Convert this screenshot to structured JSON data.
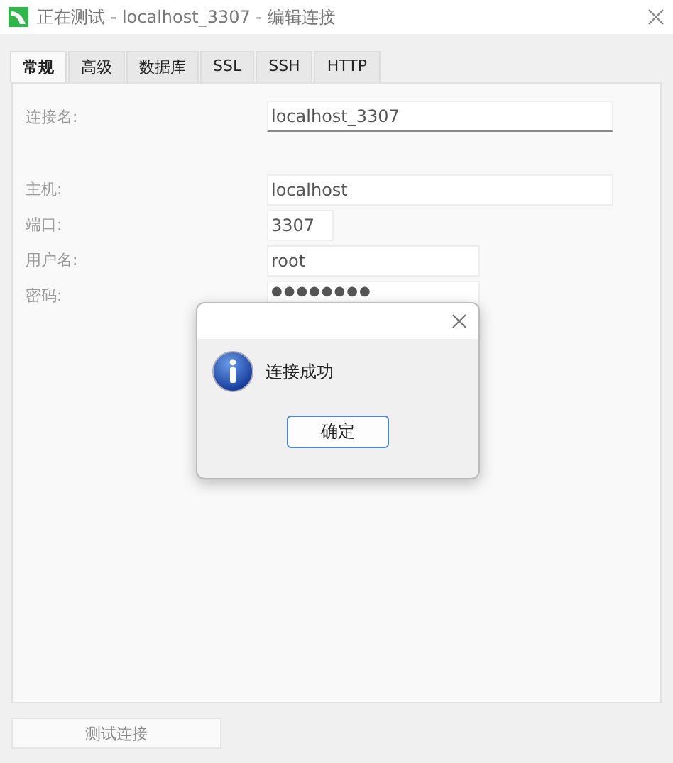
{
  "window": {
    "title": "正在测试 - localhost_3307 - 编辑连接"
  },
  "tabs": [
    {
      "label": "常规",
      "selected": true
    },
    {
      "label": "高级",
      "selected": false
    },
    {
      "label": "数据库",
      "selected": false
    },
    {
      "label": "SSL",
      "selected": false
    },
    {
      "label": "SSH",
      "selected": false
    },
    {
      "label": "HTTP",
      "selected": false
    }
  ],
  "fields": [
    {
      "label": "连接名:",
      "value": "localhost_3307",
      "kind": "wide",
      "gap": true
    },
    {
      "label": "主机:",
      "value": "localhost",
      "kind": "wide"
    },
    {
      "label": "端口:",
      "value": "3307",
      "kind": "short"
    },
    {
      "label": "用户名:",
      "value": "root",
      "kind": "medium"
    },
    {
      "label": "密码:",
      "value": "●●●●●●●●",
      "kind": "medium"
    }
  ],
  "dialog": {
    "message": "连接成功",
    "button": "确定"
  },
  "footer": {
    "test_button": "测试连接"
  }
}
